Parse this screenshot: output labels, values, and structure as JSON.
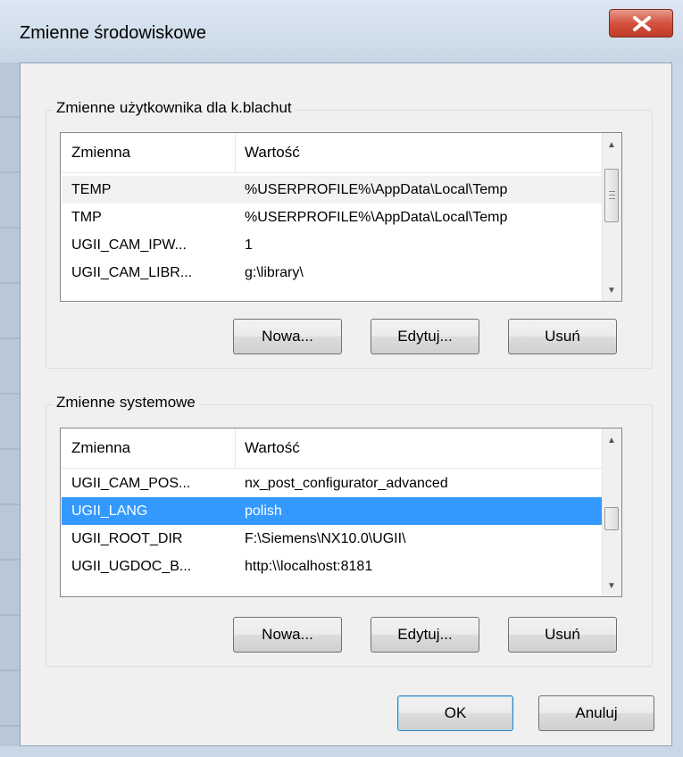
{
  "window": {
    "title": "Zmienne środowiskowe"
  },
  "user_group": {
    "label": "Zmienne użytkownika dla k.blachut",
    "headers": [
      "Zmienna",
      "Wartość"
    ],
    "rows": [
      {
        "name": "TEMP",
        "value": "%USERPROFILE%\\AppData\\Local\\Temp"
      },
      {
        "name": "TMP",
        "value": "%USERPROFILE%\\AppData\\Local\\Temp"
      },
      {
        "name": "UGII_CAM_IPW...",
        "value": "1"
      },
      {
        "name": "UGII_CAM_LIBR...",
        "value": "g:\\library\\"
      }
    ],
    "buttons": {
      "new": "Nowa...",
      "edit": "Edytuj...",
      "delete": "Usuń"
    }
  },
  "system_group": {
    "label": "Zmienne systemowe",
    "headers": [
      "Zmienna",
      "Wartość"
    ],
    "rows": [
      {
        "name": "UGII_CAM_POS...",
        "value": "nx_post_configurator_advanced"
      },
      {
        "name": "UGII_LANG",
        "value": "polish"
      },
      {
        "name": "UGII_ROOT_DIR",
        "value": "F:\\Siemens\\NX10.0\\UGII\\"
      },
      {
        "name": "UGII_UGDOC_B...",
        "value": "http:\\\\localhost:8181"
      }
    ],
    "selected_row": "UGII_LANG",
    "buttons": {
      "new": "Nowa...",
      "edit": "Edytuj...",
      "delete": "Usuń"
    }
  },
  "footer": {
    "ok": "OK",
    "cancel": "Anuluj"
  }
}
